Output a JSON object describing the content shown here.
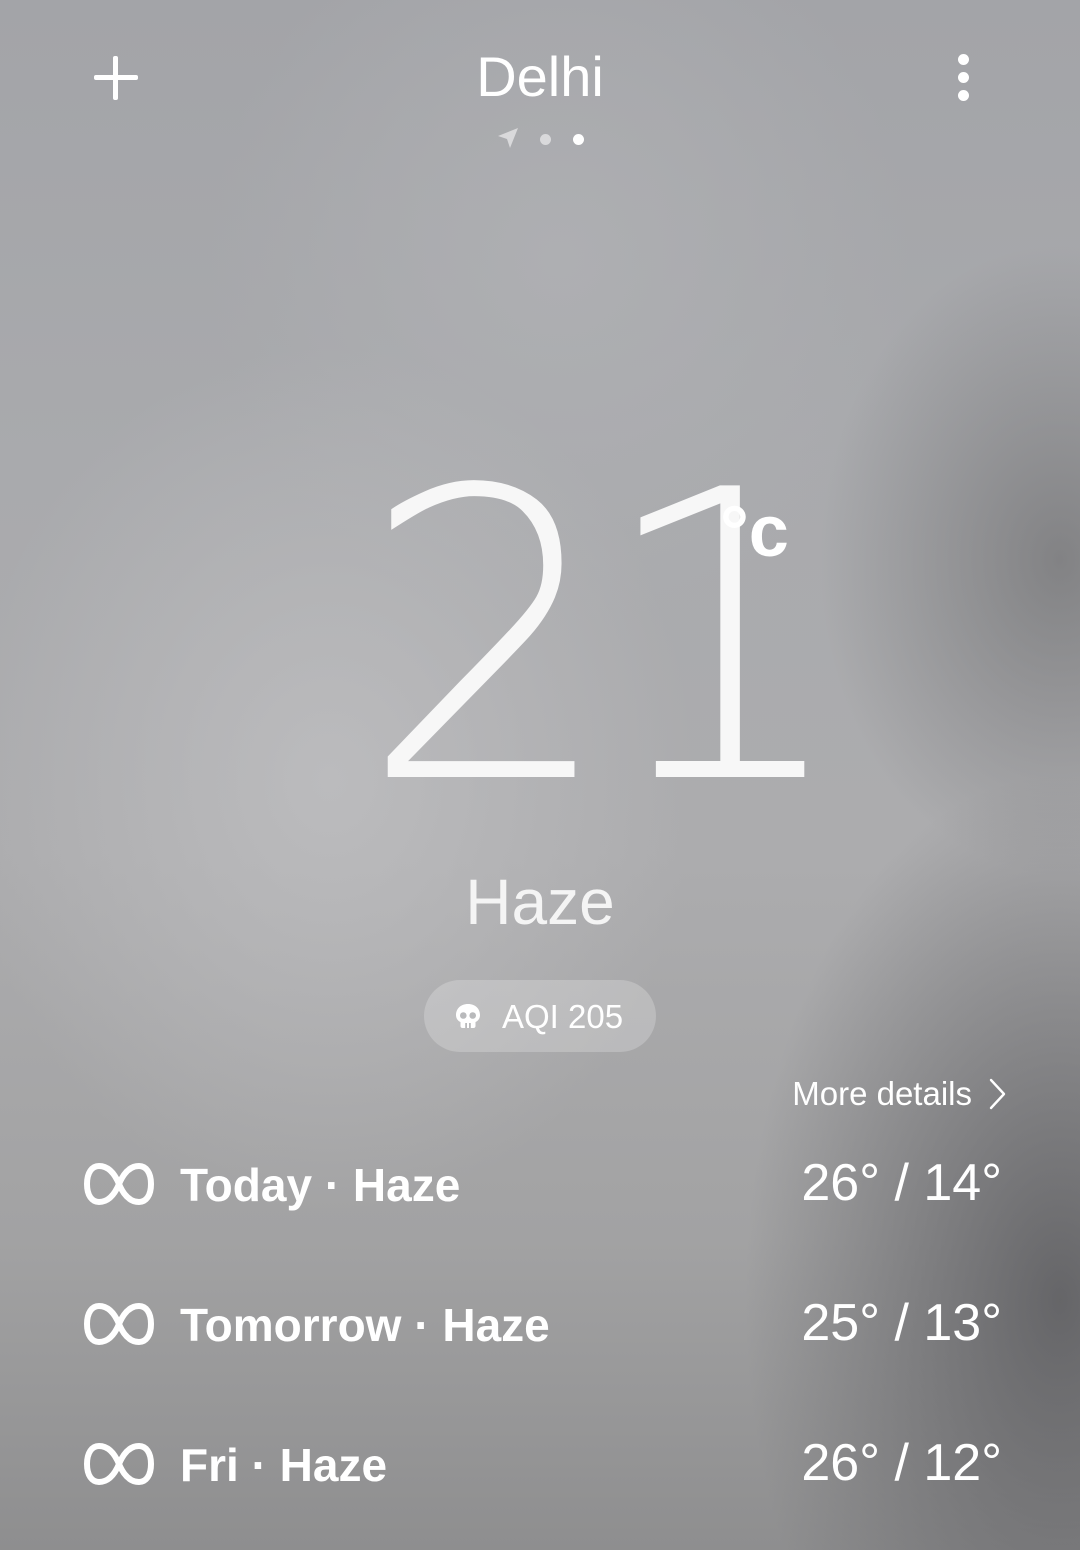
{
  "header": {
    "add_icon": "plus-icon",
    "city": "Delhi",
    "menu_icon": "more-vert-icon",
    "pages": [
      {
        "type": "current-location",
        "icon": "navigation-arrow-icon",
        "active": false
      },
      {
        "type": "dot",
        "active": false
      },
      {
        "type": "dot",
        "active": true
      }
    ]
  },
  "current": {
    "temperature": "21",
    "unit": "°c",
    "condition": "Haze",
    "aqi": {
      "icon": "skull-icon",
      "label": "AQI 205"
    }
  },
  "more_details": {
    "label": "More details",
    "icon": "chevron-right-icon"
  },
  "forecast": [
    {
      "icon": "haze-icon",
      "label": "Today · Haze",
      "range": "26° / 14°"
    },
    {
      "icon": "haze-icon",
      "label": "Tomorrow · Haze",
      "range": "25° / 13°"
    },
    {
      "icon": "haze-icon",
      "label": "Fri · Haze",
      "range": "26° / 12°"
    }
  ],
  "colors": {
    "text": "#ffffff",
    "background": "#a9aaad",
    "pill": "rgba(255,255,255,0.22)"
  }
}
